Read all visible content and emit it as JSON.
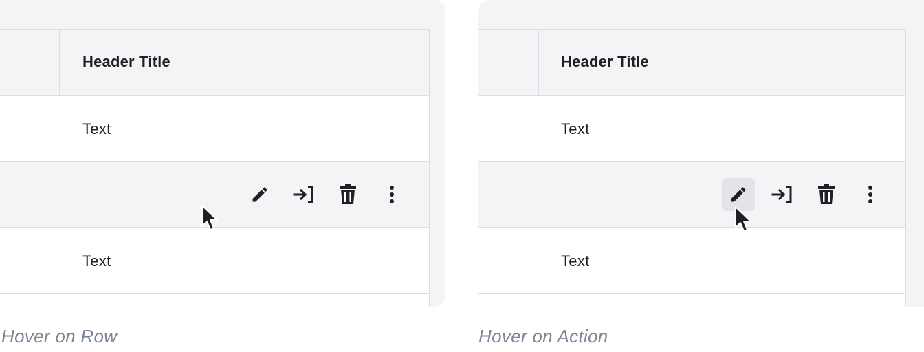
{
  "panels": [
    {
      "header_title": "Header Title",
      "row1_text": "Text",
      "row3_text": "Text",
      "caption": "Hover on Row",
      "actions": [
        "edit-icon",
        "move-to-icon",
        "delete-icon",
        "more-vertical-icon"
      ],
      "hovered_action": null
    },
    {
      "header_title": "Header Title",
      "row1_text": "Text",
      "row3_text": "Text",
      "caption": "Hover on Action",
      "actions": [
        "edit-icon",
        "move-to-icon",
        "delete-icon",
        "more-vertical-icon"
      ],
      "hovered_action": "edit-icon"
    }
  ],
  "colors": {
    "panel_bg": "#f3f4f6",
    "row_bg": "#ffffff",
    "border": "#dcdee2",
    "text": "#1f2023",
    "caption": "#7c8795",
    "action_hover_bg": "#e2e4e8"
  }
}
